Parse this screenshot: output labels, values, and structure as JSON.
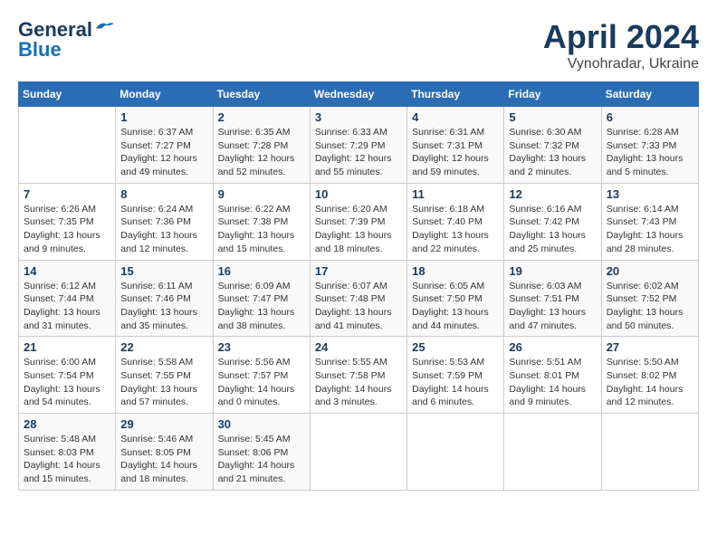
{
  "header": {
    "logo_line1": "General",
    "logo_line2": "Blue",
    "title": "April 2024",
    "subtitle": "Vynohradar, Ukraine"
  },
  "weekdays": [
    "Sunday",
    "Monday",
    "Tuesday",
    "Wednesday",
    "Thursday",
    "Friday",
    "Saturday"
  ],
  "weeks": [
    [
      {
        "day": "",
        "info": ""
      },
      {
        "day": "1",
        "info": "Sunrise: 6:37 AM\nSunset: 7:27 PM\nDaylight: 12 hours\nand 49 minutes."
      },
      {
        "day": "2",
        "info": "Sunrise: 6:35 AM\nSunset: 7:28 PM\nDaylight: 12 hours\nand 52 minutes."
      },
      {
        "day": "3",
        "info": "Sunrise: 6:33 AM\nSunset: 7:29 PM\nDaylight: 12 hours\nand 55 minutes."
      },
      {
        "day": "4",
        "info": "Sunrise: 6:31 AM\nSunset: 7:31 PM\nDaylight: 12 hours\nand 59 minutes."
      },
      {
        "day": "5",
        "info": "Sunrise: 6:30 AM\nSunset: 7:32 PM\nDaylight: 13 hours\nand 2 minutes."
      },
      {
        "day": "6",
        "info": "Sunrise: 6:28 AM\nSunset: 7:33 PM\nDaylight: 13 hours\nand 5 minutes."
      }
    ],
    [
      {
        "day": "7",
        "info": "Sunrise: 6:26 AM\nSunset: 7:35 PM\nDaylight: 13 hours\nand 9 minutes."
      },
      {
        "day": "8",
        "info": "Sunrise: 6:24 AM\nSunset: 7:36 PM\nDaylight: 13 hours\nand 12 minutes."
      },
      {
        "day": "9",
        "info": "Sunrise: 6:22 AM\nSunset: 7:38 PM\nDaylight: 13 hours\nand 15 minutes."
      },
      {
        "day": "10",
        "info": "Sunrise: 6:20 AM\nSunset: 7:39 PM\nDaylight: 13 hours\nand 18 minutes."
      },
      {
        "day": "11",
        "info": "Sunrise: 6:18 AM\nSunset: 7:40 PM\nDaylight: 13 hours\nand 22 minutes."
      },
      {
        "day": "12",
        "info": "Sunrise: 6:16 AM\nSunset: 7:42 PM\nDaylight: 13 hours\nand 25 minutes."
      },
      {
        "day": "13",
        "info": "Sunrise: 6:14 AM\nSunset: 7:43 PM\nDaylight: 13 hours\nand 28 minutes."
      }
    ],
    [
      {
        "day": "14",
        "info": "Sunrise: 6:12 AM\nSunset: 7:44 PM\nDaylight: 13 hours\nand 31 minutes."
      },
      {
        "day": "15",
        "info": "Sunrise: 6:11 AM\nSunset: 7:46 PM\nDaylight: 13 hours\nand 35 minutes."
      },
      {
        "day": "16",
        "info": "Sunrise: 6:09 AM\nSunset: 7:47 PM\nDaylight: 13 hours\nand 38 minutes."
      },
      {
        "day": "17",
        "info": "Sunrise: 6:07 AM\nSunset: 7:48 PM\nDaylight: 13 hours\nand 41 minutes."
      },
      {
        "day": "18",
        "info": "Sunrise: 6:05 AM\nSunset: 7:50 PM\nDaylight: 13 hours\nand 44 minutes."
      },
      {
        "day": "19",
        "info": "Sunrise: 6:03 AM\nSunset: 7:51 PM\nDaylight: 13 hours\nand 47 minutes."
      },
      {
        "day": "20",
        "info": "Sunrise: 6:02 AM\nSunset: 7:52 PM\nDaylight: 13 hours\nand 50 minutes."
      }
    ],
    [
      {
        "day": "21",
        "info": "Sunrise: 6:00 AM\nSunset: 7:54 PM\nDaylight: 13 hours\nand 54 minutes."
      },
      {
        "day": "22",
        "info": "Sunrise: 5:58 AM\nSunset: 7:55 PM\nDaylight: 13 hours\nand 57 minutes."
      },
      {
        "day": "23",
        "info": "Sunrise: 5:56 AM\nSunset: 7:57 PM\nDaylight: 14 hours\nand 0 minutes."
      },
      {
        "day": "24",
        "info": "Sunrise: 5:55 AM\nSunset: 7:58 PM\nDaylight: 14 hours\nand 3 minutes."
      },
      {
        "day": "25",
        "info": "Sunrise: 5:53 AM\nSunset: 7:59 PM\nDaylight: 14 hours\nand 6 minutes."
      },
      {
        "day": "26",
        "info": "Sunrise: 5:51 AM\nSunset: 8:01 PM\nDaylight: 14 hours\nand 9 minutes."
      },
      {
        "day": "27",
        "info": "Sunrise: 5:50 AM\nSunset: 8:02 PM\nDaylight: 14 hours\nand 12 minutes."
      }
    ],
    [
      {
        "day": "28",
        "info": "Sunrise: 5:48 AM\nSunset: 8:03 PM\nDaylight: 14 hours\nand 15 minutes."
      },
      {
        "day": "29",
        "info": "Sunrise: 5:46 AM\nSunset: 8:05 PM\nDaylight: 14 hours\nand 18 minutes."
      },
      {
        "day": "30",
        "info": "Sunrise: 5:45 AM\nSunset: 8:06 PM\nDaylight: 14 hours\nand 21 minutes."
      },
      {
        "day": "",
        "info": ""
      },
      {
        "day": "",
        "info": ""
      },
      {
        "day": "",
        "info": ""
      },
      {
        "day": "",
        "info": ""
      }
    ]
  ]
}
